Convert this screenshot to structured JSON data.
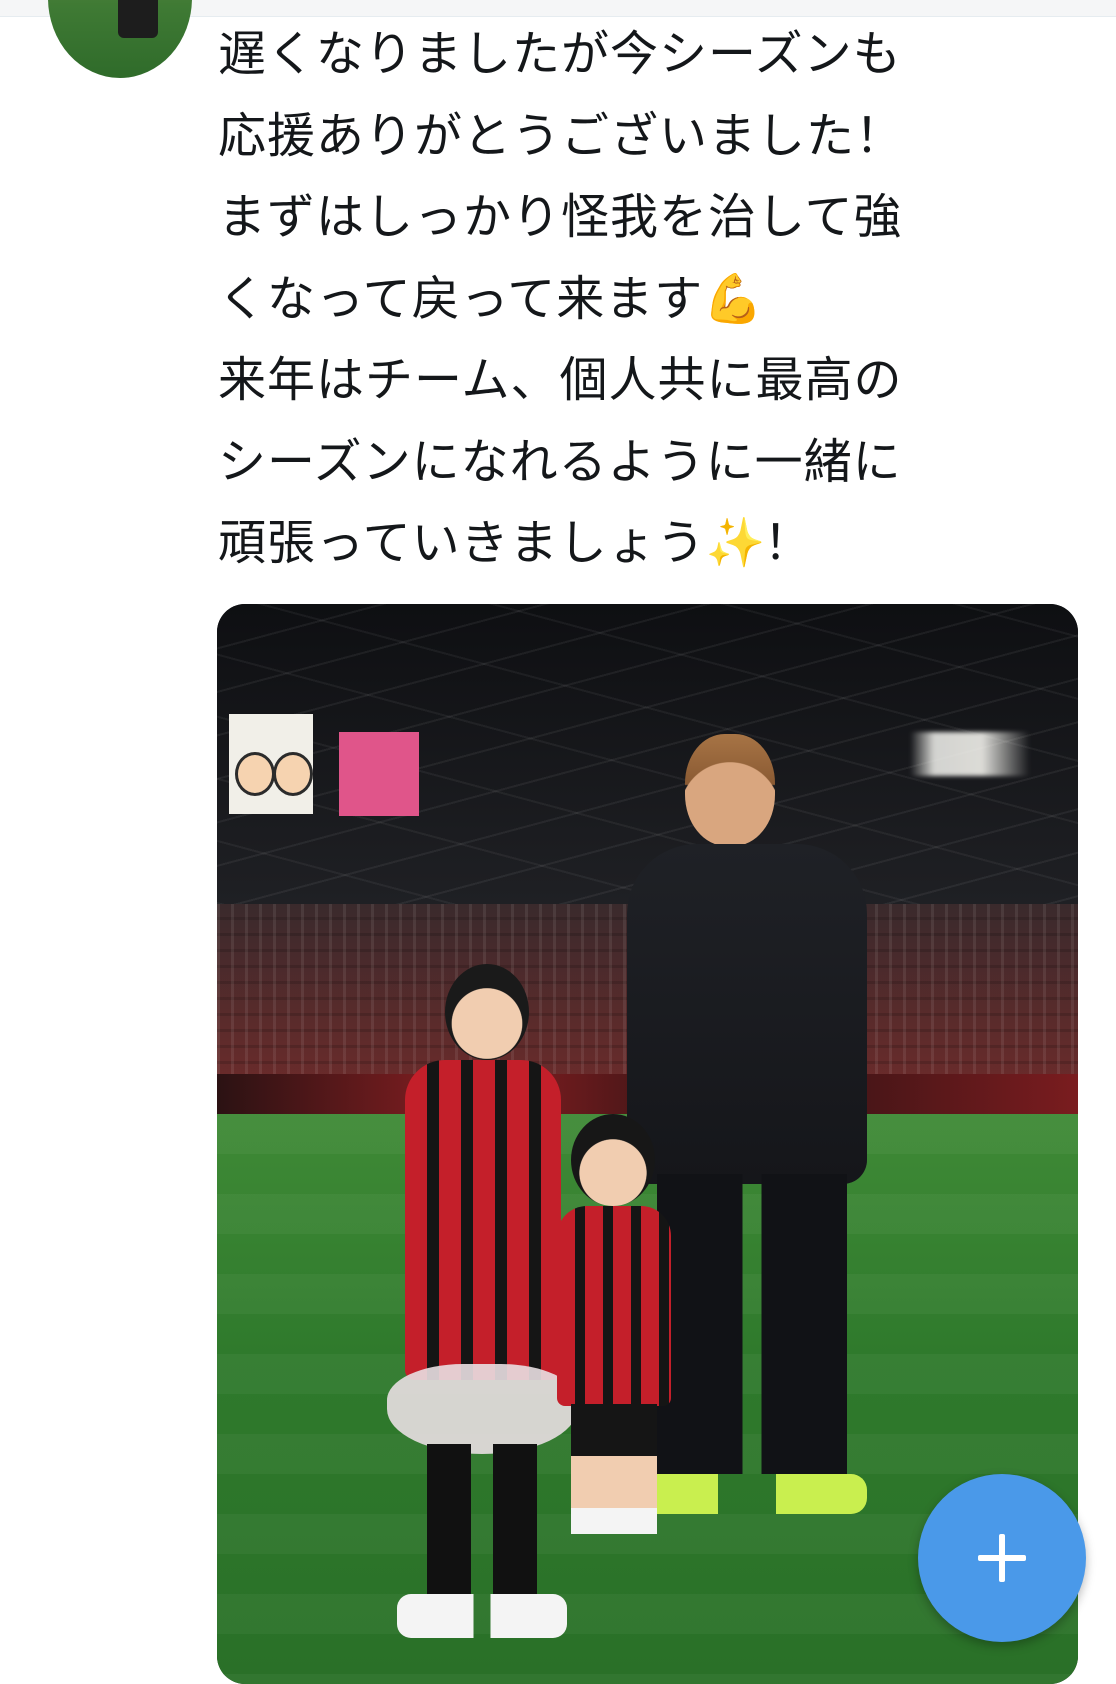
{
  "tweet": {
    "lines": [
      "遅くなりましたが今シーズンも",
      "応援ありがとうございました！",
      "まずはしっかり怪我を治して強",
      "くなって戻って来ます",
      "来年はチーム、個人共に最高の",
      "シーズンになれるように一緒に",
      "頑張っていきましょう"
    ],
    "line4_emoji": "💪",
    "line7_emoji": "✨",
    "line7_suffix": "！"
  },
  "icons": {
    "avatar": "avatar-image",
    "fab": "plus-icon"
  },
  "colors": {
    "fab_background": "#4a99e9",
    "text": "#14171a"
  }
}
